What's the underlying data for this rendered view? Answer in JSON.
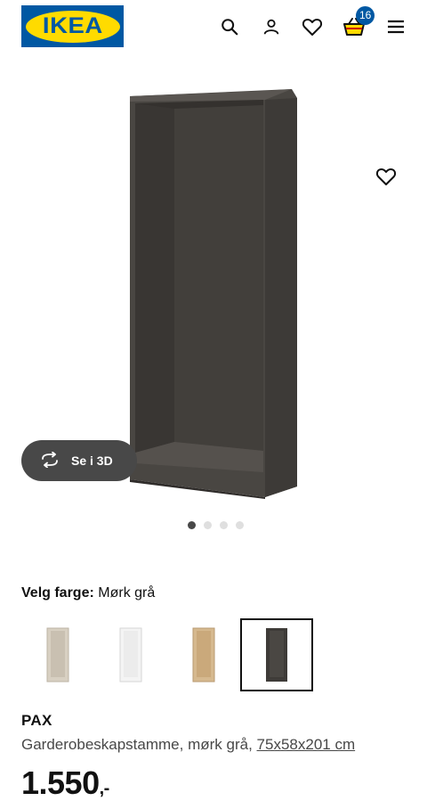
{
  "header": {
    "logo_text": "IKEA",
    "cart_count": "16",
    "icons": [
      "search-icon",
      "user-icon",
      "heart-icon",
      "basket-icon",
      "menu-icon"
    ],
    "colors": {
      "brand_blue": "#0058a3",
      "brand_yellow": "#ffdb00"
    }
  },
  "gallery": {
    "view_3d_label": "Se i 3D",
    "dots": {
      "count": 4,
      "active_index": 0
    }
  },
  "color_select": {
    "label": "Velg farge:",
    "value": "Mørk grå",
    "options": [
      {
        "name": "hvitbeiset eikemønstret",
        "color": "#d8d0c2",
        "selected": false
      },
      {
        "name": "hvit",
        "color": "#f4f4f4",
        "selected": false
      },
      {
        "name": "eikemønstret",
        "color": "#d6b98f",
        "selected": false
      },
      {
        "name": "mørk grå",
        "color": "#3e3b38",
        "selected": true
      }
    ]
  },
  "product": {
    "name": "PAX",
    "description": "Garderobeskapstamme, mørk grå,",
    "dimensions": "75x58x201 cm",
    "price": "1.550",
    "price_suffix": ",-"
  }
}
